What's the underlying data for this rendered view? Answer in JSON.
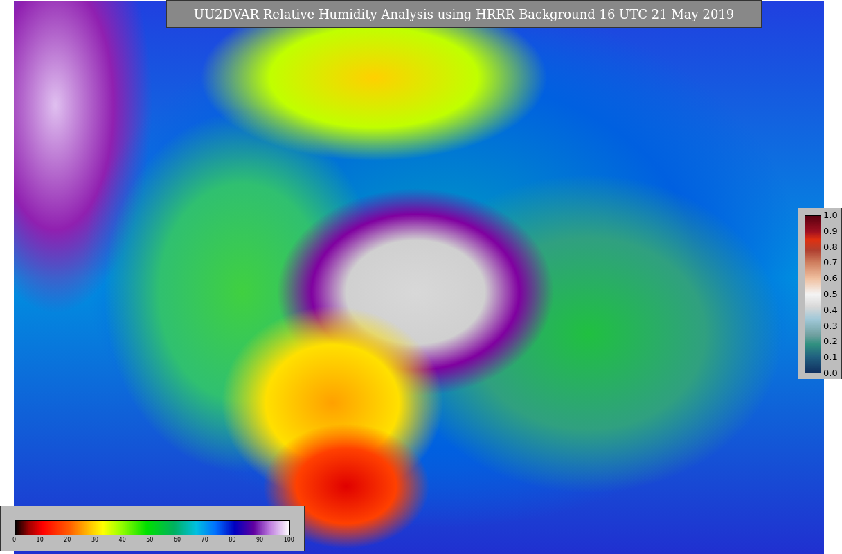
{
  "title": "UU2DVAR Relative Humidity Analysis using HRRR Background 16 UTC 21 May 2019",
  "ratio_colorbar": {
    "ticks": [
      "1.0",
      "0.9",
      "0.8",
      "0.7",
      "0.6",
      "0.5",
      "0.4",
      "0.3",
      "0.2",
      "0.1",
      "0.0"
    ]
  },
  "humidity_colorbar": {
    "ticks": [
      "0",
      "10",
      "20",
      "30",
      "40",
      "50",
      "60",
      "70",
      "80",
      "90",
      "100"
    ]
  }
}
